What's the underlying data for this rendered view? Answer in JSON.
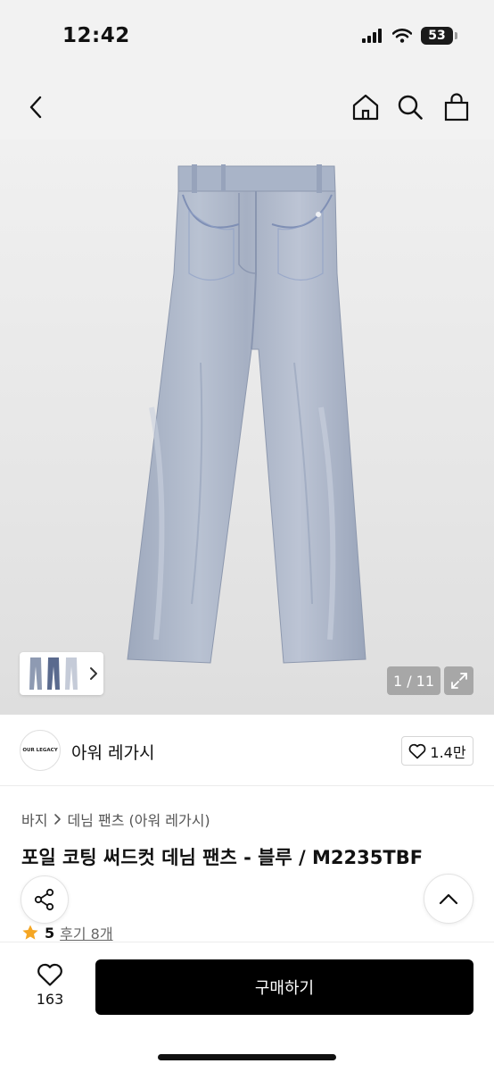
{
  "status_bar": {
    "time": "12:42",
    "battery": "53",
    "icons": [
      "signal-icon",
      "wifi-icon",
      "battery-icon"
    ]
  },
  "nav": {
    "icons": [
      "back-icon",
      "home-icon",
      "search-icon",
      "bag-icon"
    ]
  },
  "gallery": {
    "page_counter": "1 / 11",
    "current_page": 1,
    "total_pages": 11
  },
  "brand": {
    "logo_text": "OUR LEGACY",
    "name": "아워 레가시",
    "likes": "1.4만"
  },
  "breadcrumb": {
    "category": "바지",
    "subcategory": "데님 팬츠 (아워 레가시)"
  },
  "product": {
    "title": "포일 코팅 써드컷 데님 팬츠 - 블루 / M2235TBF",
    "rating": "5",
    "reviews_label": "후기 8개"
  },
  "bottom_bar": {
    "wish_count": "163",
    "buy_label": "구매하기"
  },
  "colors": {
    "background": "#ffffff",
    "header_bg": "#f2f2f2",
    "buy_button": "#000000",
    "star": "#f5a623",
    "denim": "#aab5c9"
  }
}
